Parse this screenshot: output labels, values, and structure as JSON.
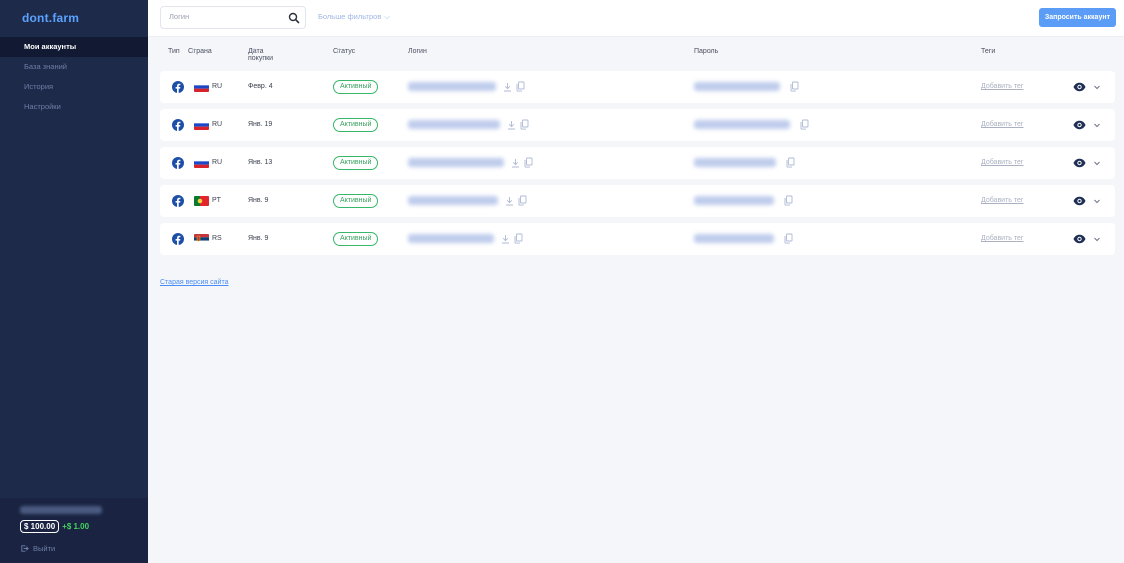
{
  "sidebar": {
    "logo": "dont.farm",
    "nav": [
      {
        "label": "Мои аккаунты",
        "active": true
      },
      {
        "label": "База знаний",
        "active": false
      },
      {
        "label": "История",
        "active": false
      },
      {
        "label": "Настройки",
        "active": false
      }
    ],
    "balance": "$ 100.00",
    "bonus": "+$ 1.00",
    "logout_label": "Выйти"
  },
  "topbar": {
    "search_placeholder": "Логин",
    "more_filters": "Больше фильтров",
    "request_button": "Запросить аккаунт"
  },
  "table": {
    "headers": {
      "type": "Тип",
      "country": "Страна",
      "purchase_date": "Дата покупки",
      "status": "Статус",
      "login": "Логин",
      "password": "Пароль",
      "tags": "Теги"
    },
    "rows": [
      {
        "type_icon": "facebook-icon",
        "flag": "flag-ru",
        "country": "RU",
        "date": "Февр. 4",
        "status": "Активный",
        "add_tag": "Добавить тег"
      },
      {
        "type_icon": "facebook-icon",
        "flag": "flag-ru",
        "country": "RU",
        "date": "Янв. 19",
        "status": "Активный",
        "add_tag": "Добавить тег"
      },
      {
        "type_icon": "facebook-icon",
        "flag": "flag-ru",
        "country": "RU",
        "date": "Янв. 13",
        "status": "Активный",
        "add_tag": "Добавить тег"
      },
      {
        "type_icon": "facebook-icon",
        "flag": "flag-pt",
        "country": "PT",
        "date": "Янв. 9",
        "status": "Активный",
        "add_tag": "Добавить тег"
      },
      {
        "type_icon": "facebook-icon",
        "flag": "flag-rs",
        "country": "RS",
        "date": "Янв. 9",
        "status": "Активный",
        "add_tag": "Добавить тег"
      }
    ]
  },
  "footer_link": "Старая версия сайта",
  "colors": {
    "sidebar_bg": "#1e2a4a",
    "accent": "#5b9cf7",
    "status_green": "#38b76a",
    "bonus_green": "#43d35d"
  }
}
